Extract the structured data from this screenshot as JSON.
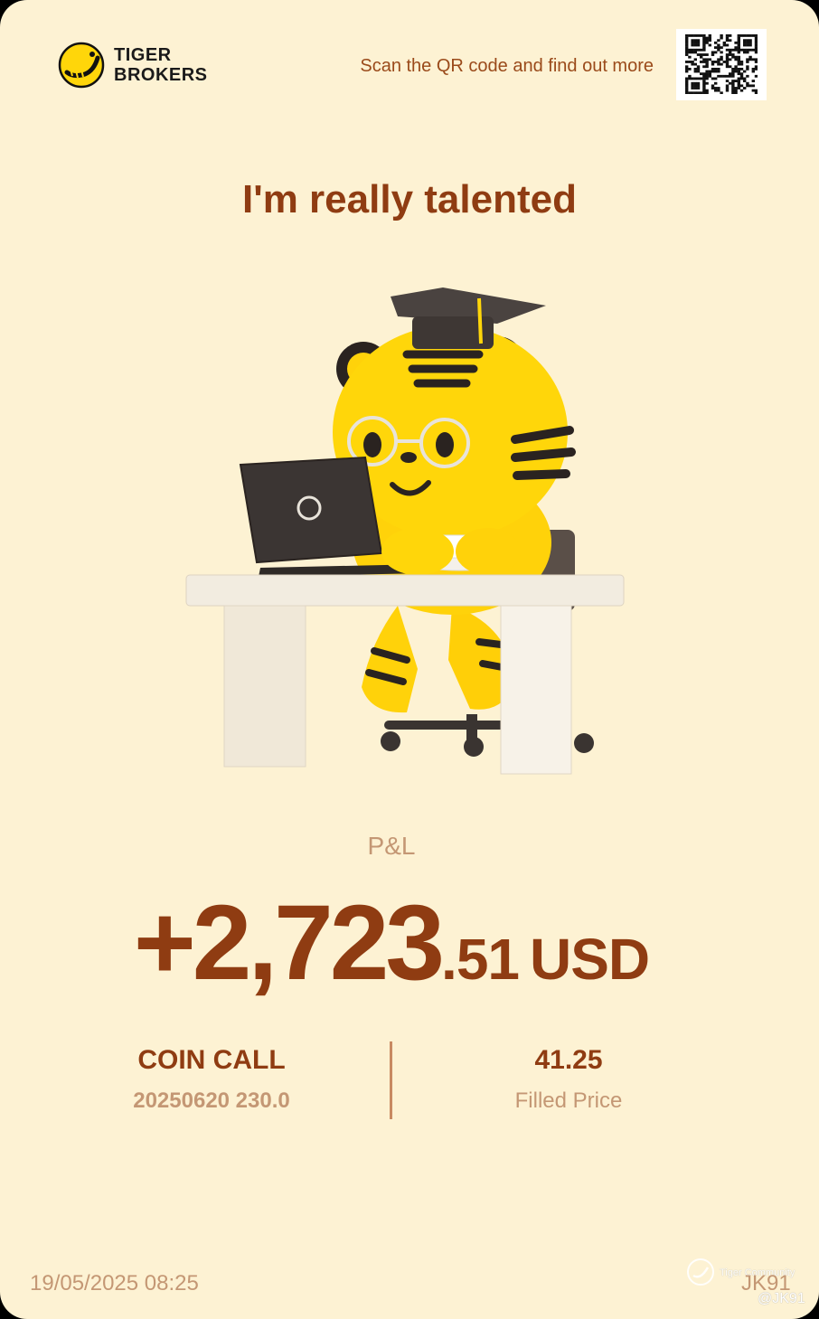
{
  "header": {
    "brand_line1": "TIGER",
    "brand_line2": "BROKERS",
    "scan_text": "Scan the QR code and find out more"
  },
  "headline": "I'm really talented",
  "pnl": {
    "label": "P&L",
    "main": "+2,723",
    "decimal": ".51",
    "currency": "USD"
  },
  "contract": {
    "title": "COIN CALL",
    "detail": "20250620 230.0"
  },
  "price": {
    "value": "41.25",
    "label": "Filled Price"
  },
  "footer": {
    "timestamp": "19/05/2025 08:25",
    "watermark_text": "Tiger Community",
    "username": "JK91",
    "handle": "@JK91"
  },
  "colors": {
    "background": "#fdf2d3",
    "primary_text": "#8f3c12",
    "muted_text": "#c49774",
    "brand_yellow": "#ffd60a"
  },
  "icons": {
    "logo": "tiger-logo-icon",
    "qr": "qr-code-icon",
    "illustration": "tiger-mascot-at-desk",
    "watermark": "tiger-community-icon"
  }
}
